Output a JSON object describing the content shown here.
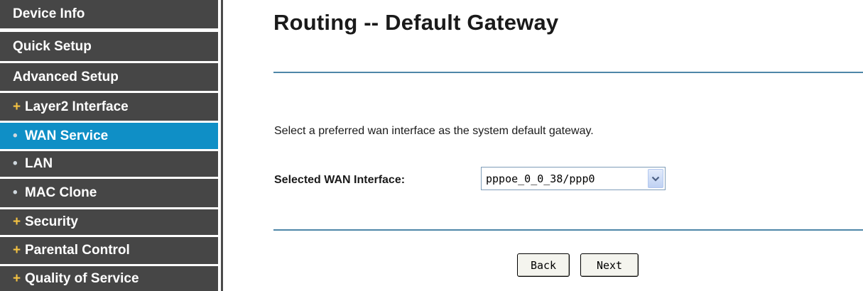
{
  "sidebar": {
    "items": [
      {
        "label": "Device Info",
        "bullet": ""
      },
      {
        "label": "Quick Setup",
        "bullet": ""
      },
      {
        "label": "Advanced Setup",
        "bullet": ""
      },
      {
        "label": "Layer2 Interface",
        "bullet": "+"
      },
      {
        "label": "WAN Service",
        "bullet": "•"
      },
      {
        "label": "LAN",
        "bullet": "•"
      },
      {
        "label": "MAC Clone",
        "bullet": "•"
      },
      {
        "label": "Security",
        "bullet": "+"
      },
      {
        "label": "Parental Control",
        "bullet": "+"
      },
      {
        "label": "Quality of Service",
        "bullet": "+"
      }
    ],
    "active_item": "WAN Service"
  },
  "main": {
    "title": "Routing -- Default Gateway",
    "description": "Select a preferred wan interface as the system default gateway.",
    "wan_interface": {
      "label": "Selected WAN Interface:",
      "selected_value": "pppoe_0_0_38/ppp0"
    },
    "buttons": {
      "back_label": "Back",
      "next_label": "Next"
    }
  },
  "colors": {
    "sidebar_bg": "#464646",
    "sidebar_active_bg": "#0f8fc6",
    "plus_bullet": "#f4c242",
    "rule": "#4e87a8"
  }
}
